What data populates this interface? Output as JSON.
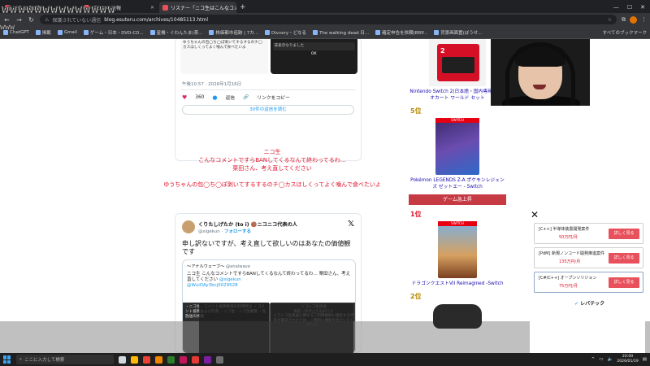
{
  "browser": {
    "tabs": [
      {
        "label": "ぼうせる速報",
        "active": false,
        "color": "#e8505b"
      },
      {
        "label": "ぼうせる速報",
        "active": false,
        "color": "#e8505b"
      },
      {
        "label": "リスナー「ニコ生はこんなコメントですら",
        "active": true,
        "color": "#e8505b"
      }
    ],
    "security_text": "保護されていない通信",
    "url": "blog.esuteru.com/archives/10485113.html",
    "bookmarks": [
      "ChatGPT",
      "掲載",
      "Gmail",
      "ゲーム・日本・DVD-CD...",
      "星機・ぐわんたま(茶...",
      "株価都市追跡 | 7カ...",
      "Divvery・どなる",
      "The walking dead 日...",
      "確定申告を依頼(BRP...",
      "背景画面置(ぼうせ..."
    ],
    "all_bookmarks": "すべてのブックマーク"
  },
  "overlay": {
    "www_big": "wwwwwwwwwwwwww",
    "www_small": "www"
  },
  "tweet1": {
    "dialog_line1": "ゆうちゃんの包◯ち◯ぽ剥いてするするのチ◯カスほしくってよく噛んで食べたいよ",
    "dialog_label": "非表示なりました",
    "ok": "OK",
    "date": "午後10:57 · 2026年1月16日",
    "likes": "360",
    "reply": "返信",
    "copy_link": "リンクをコピー",
    "read_replies": "30件の返信を読む"
  },
  "red_message": {
    "line1": "ニコ生",
    "line2": "こんなコメントですらBANしてくるなんて終わってるわ…",
    "line3": "栗田さん、考え直してください",
    "line4": "ゆうちゃんの包◯ち◯ぽ剥いてするするのチ◯カスほしくってよく噛んで食べたいよ"
  },
  "tweet2": {
    "name": "くりたしげたか (to i) 🟤ニコニコ代表の人",
    "handle": "@sigekun",
    "follow": "フォローする",
    "text": "申し訳ないですが、考え直して欲しいのはあなたの価値観です",
    "quote_user": "〜アナルウェーブ〜",
    "quote_handle": "@analwave",
    "quote_body": "ニコ生 こんなコメントですらBANしてくるなんて終わってるわ… 栗田さん、考え直してください",
    "quote_mention": "@sigekun",
    "quote_link": "@WuiOAy3bcj0029528",
    "img_left": "・ニコ生・コメント投稿者様の利用停止 ・コメント投稿および行為 ・ニコ生・ニコ生業務 ・生放送の視聴",
    "img_right_title": "ニコニコ生放送",
    "img_right_sub": "機能一時停止のお知らせ",
    "img_right_body": "ニコニコ生放送に関するご利用規約に違反する行為が確認されたため、一時的に機能を停止いたしました。"
  },
  "sidebar": {
    "product1": "Nintendo Switch 2(日本語・国内専用) マリオカート ワールド セット",
    "rank5": "5位",
    "product5": "Pokémon LEGENDS Z-A ポケモンレジェンズ ゼットエー - Switch",
    "section": "ゲーム急上昇",
    "rank1": "1位",
    "game1": "ドラゴンクエストVII Reimagined -Switch",
    "rank2": "2位"
  },
  "ads": {
    "close": "✕",
    "items": [
      {
        "title": "[C++] 半導体装置開発案件",
        "price": "50万円/月",
        "button": "詳しく見る"
      },
      {
        "title": "[PdM] 新規ノンコード開発推進案件",
        "price": "135万円/月",
        "button": "詳しく見る"
      },
      {
        "title": "[C#/C++] オープンソリジョン",
        "price": "75万円/月",
        "button": "詳しく見る"
      }
    ],
    "logo": "レバテック"
  },
  "taskbar": {
    "search_placeholder": "ここに入力して検索",
    "time": "20:00",
    "date": "2026/01/19"
  }
}
